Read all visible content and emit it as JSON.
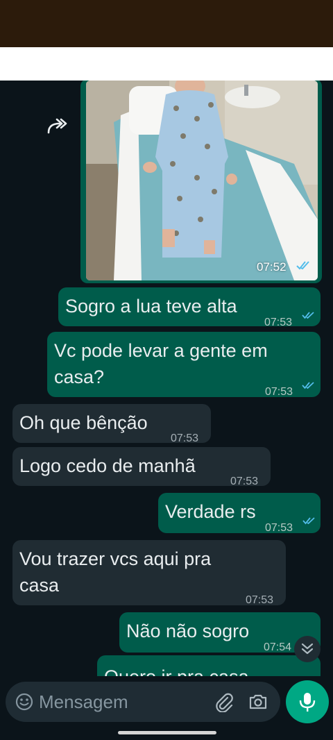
{
  "composer": {
    "placeholder": "Mensagem"
  },
  "image_message": {
    "time": "07:52"
  },
  "messages": [
    {
      "direction": "out",
      "text": "Sogro a lua teve alta",
      "time": "07:53",
      "status": "read"
    },
    {
      "direction": "out",
      "text": "Vc pode levar a gente em casa?",
      "time": "07:53",
      "status": "read"
    },
    {
      "direction": "in",
      "text": "Oh que bênção",
      "time": "07:53"
    },
    {
      "direction": "in",
      "text": "Logo cedo de manhã",
      "time": "07:53"
    },
    {
      "direction": "out",
      "text": "Verdade rs",
      "time": "07:53",
      "status": "read"
    },
    {
      "direction": "in",
      "text": "Vou trazer vcs aqui pra casa",
      "time": "07:53"
    },
    {
      "direction": "out",
      "text": "Não não sogro",
      "time": "07:54",
      "status": "read"
    },
    {
      "direction": "out",
      "text": "Quero ir pra casa",
      "time": "",
      "status": ""
    }
  ],
  "colors": {
    "outgoing_bubble": "#005c4b",
    "incoming_bubble": "#202c33",
    "background": "#0b141a",
    "accent": "#00a884",
    "read_ticks": "#53bdeb"
  },
  "icons": {
    "forward": "forward-icon",
    "scroll_down": "chevron-double-down-icon",
    "emoji": "emoji-icon",
    "attach": "paperclip-icon",
    "camera": "camera-icon",
    "mic": "mic-icon"
  }
}
